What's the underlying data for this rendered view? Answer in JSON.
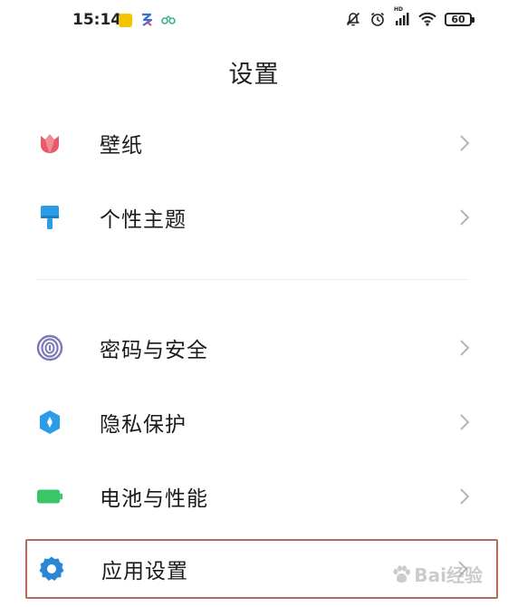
{
  "status_bar": {
    "time": "15:14",
    "battery": "60",
    "network": "HD",
    "notification_badge": "",
    "icons": [
      "app-badge-icon",
      "signal-app-icon",
      "mini-app-icon",
      "mute-bell-icon",
      "alarm-icon",
      "cellular-signal-icon",
      "wifi-icon",
      "battery-icon"
    ]
  },
  "header": {
    "title": "设置"
  },
  "sections": [
    {
      "items": [
        {
          "label": "壁纸",
          "icon": "wallpaper-tulip-icon",
          "color": "#e85a6a"
        },
        {
          "label": "个性主题",
          "icon": "theme-brush-icon",
          "color": "#2b9ce8"
        }
      ]
    },
    {
      "items": [
        {
          "label": "密码与安全",
          "icon": "fingerprint-icon",
          "color": "#7a7ab8"
        },
        {
          "label": "隐私保护",
          "icon": "privacy-shield-icon",
          "color": "#2b9ce8"
        },
        {
          "label": "电池与性能",
          "icon": "battery-performance-icon",
          "color": "#3ac567"
        },
        {
          "label": "应用设置",
          "icon": "gear-icon",
          "color": "#2b86d6",
          "highlighted": true
        }
      ]
    }
  ],
  "watermark": {
    "text": "Bai经验",
    "paw_icon": "paw-icon"
  }
}
